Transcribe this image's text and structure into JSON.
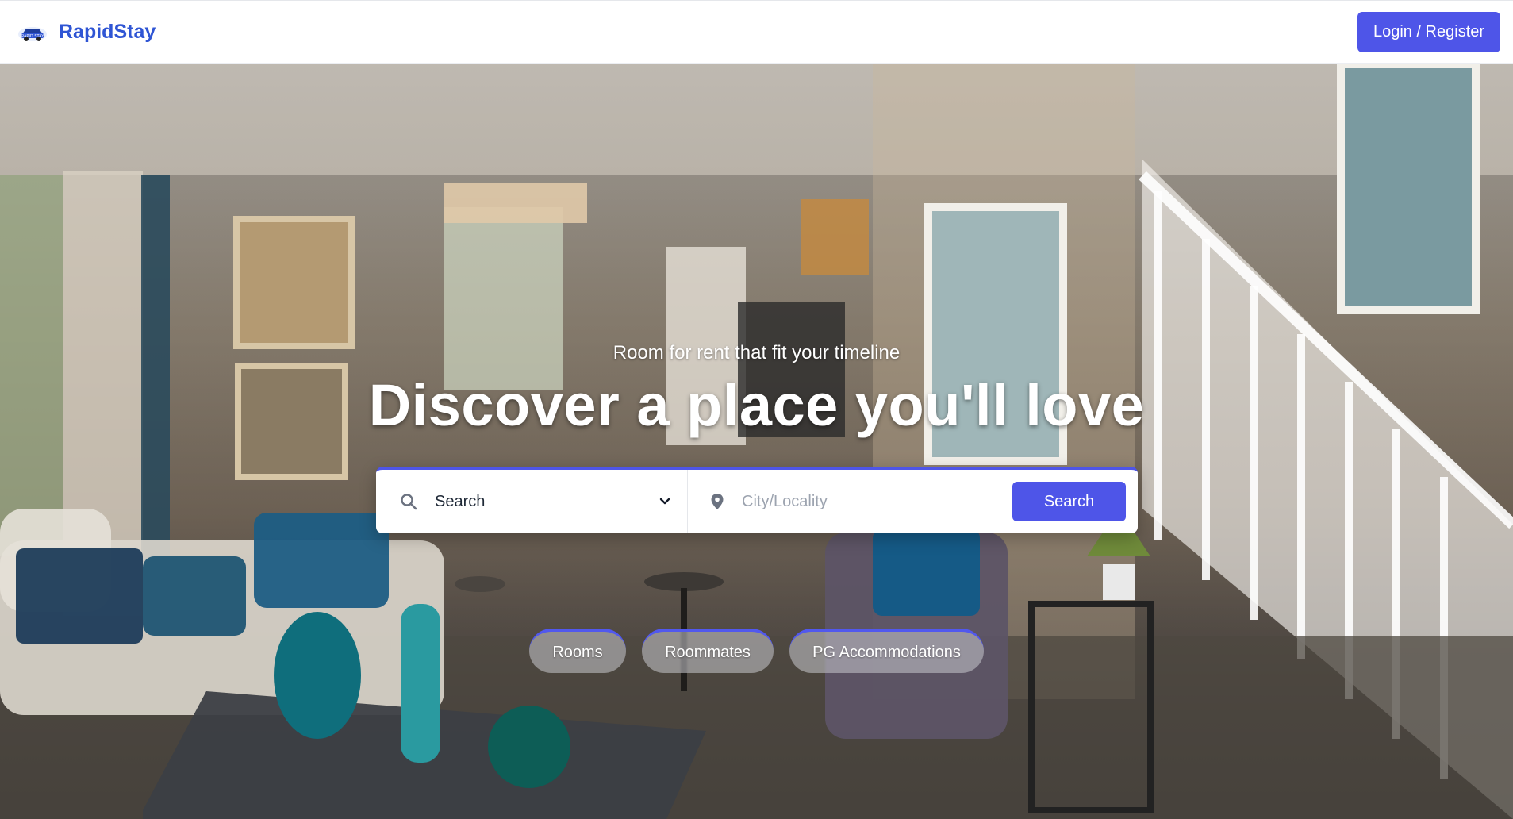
{
  "header": {
    "brand_name": "RapidStay",
    "logo_icon": "car-logo-icon",
    "logo_text": "RAPID STAY",
    "login_label": "Login / Register"
  },
  "hero": {
    "subtitle": "Room for rent that fit your timeline",
    "title": "Discover a place you'll love"
  },
  "search": {
    "type_selected": "Search",
    "type_icon": "search-icon",
    "dropdown_icon": "chevron-down-icon",
    "city_placeholder": "City/Locality",
    "city_value": "",
    "location_icon": "location-pin-icon",
    "button_label": "Search"
  },
  "categories": [
    {
      "label": "Rooms"
    },
    {
      "label": "Roommates"
    },
    {
      "label": "PG Accommodations"
    }
  ],
  "colors": {
    "brand": "#2f55d4",
    "accent": "#4e55e8"
  }
}
